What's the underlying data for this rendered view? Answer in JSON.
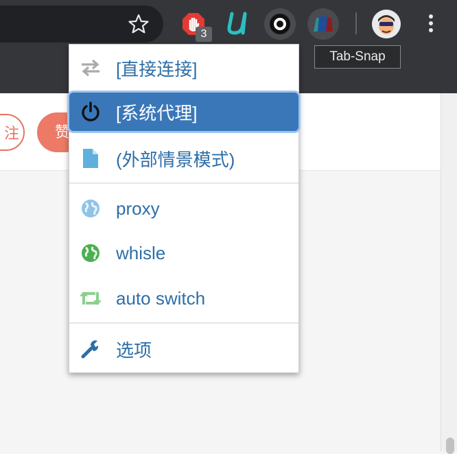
{
  "toolbar": {
    "extension_badge_count": "3",
    "tooltip": "Tab-Snap",
    "icons": [
      "star-icon",
      "stop-hand-icon",
      "u-extension-icon",
      "ring-extension-icon",
      "tab-snap-icon",
      "avatar",
      "kebab-menu-icon"
    ]
  },
  "page": {
    "pill_outline_text": "注",
    "pill_filled_text": "赞"
  },
  "menu": {
    "items": [
      {
        "label": "[直接连接]",
        "icon": "swap-arrows-icon",
        "color": "#aaaaaa"
      },
      {
        "label": "[系统代理]",
        "icon": "power-icon",
        "selected": true,
        "color": "#3a77b8"
      },
      {
        "label": "(外部情景模式)",
        "icon": "file-icon",
        "color": "#5fb0dd"
      },
      {
        "label": "proxy",
        "icon": "globe-icon",
        "color": "#8fc3e8"
      },
      {
        "label": "whisle",
        "icon": "globe-icon",
        "color": "#4caf50"
      },
      {
        "label": "auto switch",
        "icon": "retweet-icon",
        "color": "#8cd08c"
      },
      {
        "label": "选项",
        "icon": "wrench-icon",
        "color": "#2d6ea8"
      }
    ]
  }
}
